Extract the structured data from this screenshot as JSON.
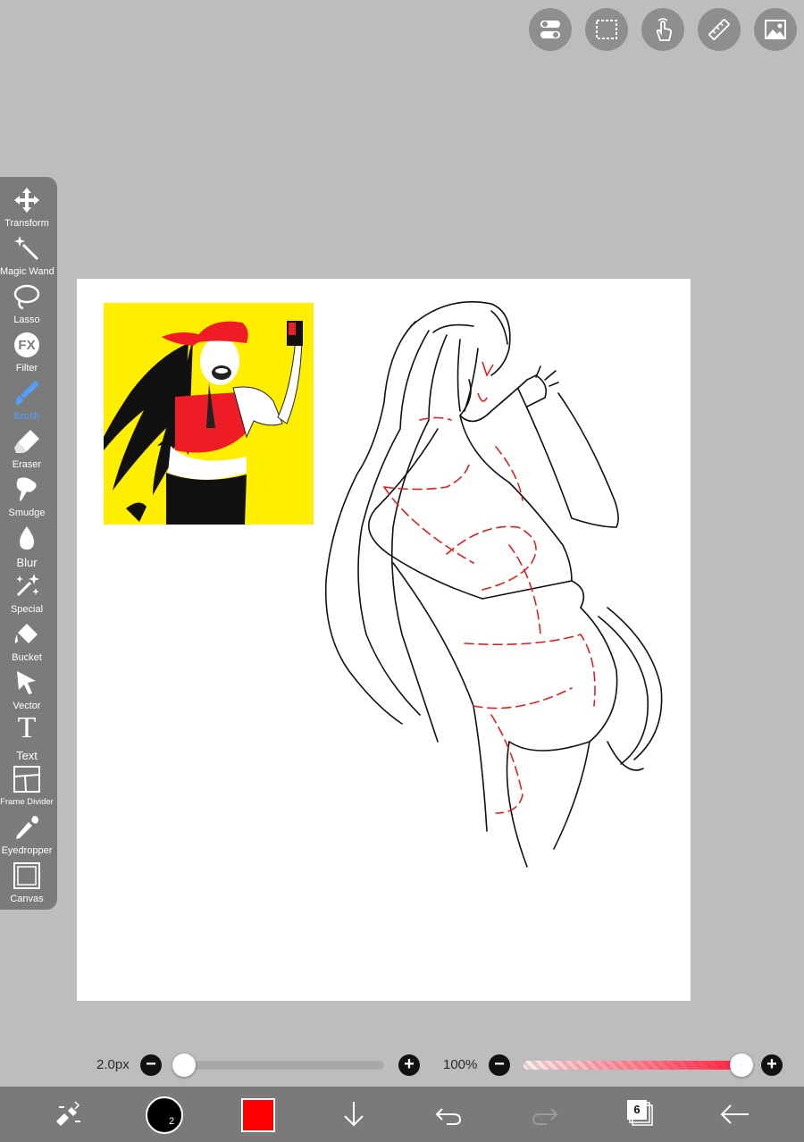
{
  "top_buttons": [
    {
      "name": "toggle-settings-icon"
    },
    {
      "name": "selection-icon"
    },
    {
      "name": "touch-gesture-icon"
    },
    {
      "name": "ruler-icon"
    },
    {
      "name": "image-import-icon"
    }
  ],
  "toolbar": {
    "tools": [
      {
        "label": "Transform"
      },
      {
        "label": "Magic Wand"
      },
      {
        "label": "Lasso"
      },
      {
        "label": "Filter",
        "icon_text": "FX"
      },
      {
        "label": "Brush"
      },
      {
        "label": "Eraser"
      },
      {
        "label": "Smudge"
      },
      {
        "label": "Blur"
      },
      {
        "label": "Special"
      },
      {
        "label": "Bucket"
      },
      {
        "label": "Vector"
      },
      {
        "label": "Text",
        "icon_text": "T"
      },
      {
        "label": "Frame Divider"
      },
      {
        "label": "Eyedropper"
      },
      {
        "label": "Canvas"
      }
    ],
    "active_tool": "Brush"
  },
  "brush_size": {
    "label": "2.0px",
    "minus": "−",
    "plus": "+",
    "level": 0.0
  },
  "opacity": {
    "label": "100%",
    "minus": "−",
    "plus": "+",
    "level": 1.0
  },
  "bottom_bar": {
    "brush_size_indicator": "2",
    "current_color": "#ff0000",
    "layer_count": "6"
  },
  "colors": {
    "accent": "#4fa0ff",
    "primary": "#ff0000",
    "reference_bg": "#ffee00"
  }
}
